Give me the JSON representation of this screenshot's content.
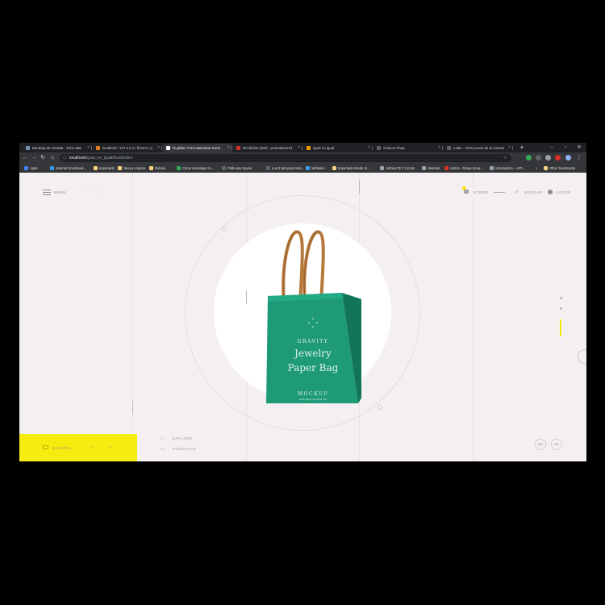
{
  "browser": {
    "tabs": [
      {
        "title": "Bandeja de entrada - Zoho Mai",
        "color": "#7b8fb3"
      },
      {
        "title": "localhost / 127.0.0.1 / fluxers / p",
        "color": "#e67e22"
      },
      {
        "title": "fa-globe: Font Awesome Icons",
        "color": "#ffffff"
      },
      {
        "title": "Recibidos (268) - pedroalvarr01",
        "color": "#d93025"
      },
      {
        "title": "Igual no igual",
        "color": "#f29900"
      },
      {
        "title": "Chanca Shop",
        "color": "#5f6368"
      },
      {
        "title": "Lolas - Vista previa de la cartera",
        "color": "#5f6368"
      }
    ],
    "url_host": "localhost",
    "url_path": "/igual_no_igual/front/index",
    "bookmarks": [
      {
        "label": "Apps",
        "color": "#4285f4"
      },
      {
        "label": "Internet Download...",
        "color": "#3d9ae8"
      },
      {
        "label": "Importado",
        "color": "#f9d27d"
      },
      {
        "label": "Nueva carpeta",
        "color": "#f9d27d"
      },
      {
        "label": "Rubios",
        "color": "#f9d27d"
      },
      {
        "label": "Cómo descargar m...",
        "color": "#34a853"
      },
      {
        "label": "Pollo-asu Kyyos",
        "color": "#5f6368"
      },
      {
        "label": "Los 8 tips para todo...",
        "color": "#5f6368"
      },
      {
        "label": "Mirladas -",
        "color": "#3d9ae8"
      },
      {
        "label": "Importado desde In...",
        "color": "#f9d27d"
      },
      {
        "label": "AdminLTE 2 | Icons",
        "color": "#9aa0a6"
      },
      {
        "label": "Historial",
        "color": "#9aa0a6"
      },
      {
        "label": "Admin - Riego Ecua...",
        "color": "#d93025"
      },
      {
        "label": "Introduction – API...",
        "color": "#9aa0a6"
      }
    ],
    "other_bookmarks": "Other bookmarks",
    "more": "»"
  },
  "header": {
    "menu_label": "MENU",
    "logo_text": "[ ]ual",
    "store_label": "STORE",
    "search_label": "BUSCAR",
    "login_label": "LOGIN"
  },
  "product": {
    "brand": "GRAVITY",
    "line1": "Jewelry",
    "line2": "Paper Bag",
    "footer": "MOCKUP",
    "tiny": "www.gravity-mockups.com",
    "bag_color": "#1f9e7a",
    "handle_color": "#b5793c"
  },
  "bottom": {
    "gallery_label": "GALERIA",
    "prev": "←",
    "next": "→",
    "links": [
      {
        "num": "01",
        "label": "EXPLORE"
      },
      {
        "num": "02",
        "label": "PURCHASE"
      }
    ],
    "lang_en": "EN",
    "lang_es": "ES",
    "accent": "#f7ec0f"
  }
}
